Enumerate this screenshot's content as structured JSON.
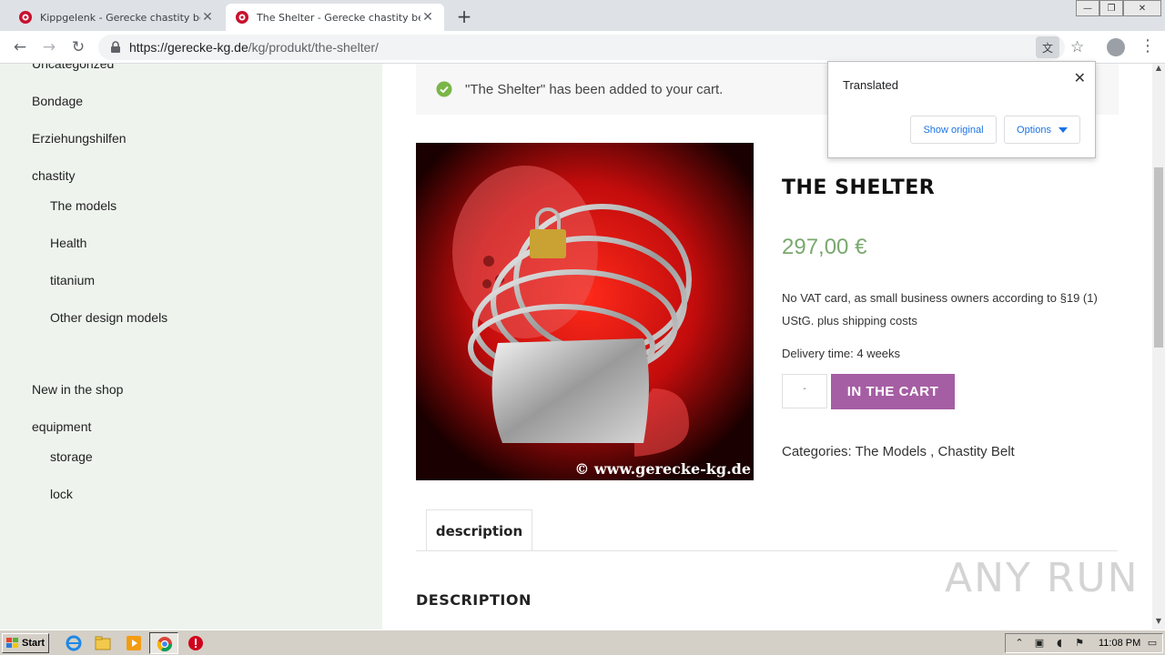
{
  "tabs": [
    {
      "title": "Kippgelenk - Gerecke chastity belt",
      "active": false
    },
    {
      "title": "The Shelter - Gerecke chastity belt",
      "active": true
    }
  ],
  "window_controls": {
    "minimize": "—",
    "restore": "❐",
    "close": "✕"
  },
  "address": {
    "domain": "https://gerecke-kg.de",
    "path": "/kg/produkt/the-shelter/"
  },
  "sidebar": {
    "items": [
      {
        "label": "Uncategorized"
      },
      {
        "label": "Bondage"
      },
      {
        "label": "Erziehungshilfen"
      },
      {
        "label": "chastity"
      },
      {
        "label": "The models"
      },
      {
        "label": "Health"
      },
      {
        "label": "titanium"
      },
      {
        "label": "Other design models"
      },
      {
        "label": "New in the shop"
      },
      {
        "label": "equipment"
      },
      {
        "label": "storage"
      },
      {
        "label": "lock"
      }
    ]
  },
  "notice": {
    "message": "\"The Shelter\" has been added to your cart."
  },
  "product": {
    "image_caption": "© www.gerecke-kg.de",
    "title": "THE SHELTER",
    "price": "297,00 €",
    "vat_note": "No VAT card, as small business owners according to §19 (1) UStG. plus shipping costs",
    "delivery": "Delivery time: 4 weeks",
    "quantity": "-",
    "cart_button": "IN THE CART",
    "categories_label": "Categories:",
    "categories": "The Models , Chastity Belt"
  },
  "description_tab": {
    "label": "description"
  },
  "description_heading": "DESCRIPTION",
  "translate_popup": {
    "title": "Translated",
    "show_original": "Show original",
    "options": "Options"
  },
  "watermark": "ANY RUN",
  "taskbar": {
    "start": "Start",
    "clock": "11:08 PM"
  },
  "colors": {
    "accent_purple": "#a55ea3",
    "price_green": "#7aa86f",
    "sidebar_bg": "#eef3ee"
  }
}
